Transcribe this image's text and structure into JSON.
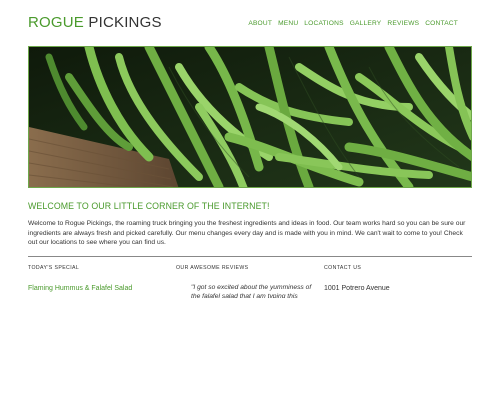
{
  "site": {
    "logo_part1": "ROGUE",
    "logo_part2": " PICKINGS"
  },
  "nav": [
    {
      "label": "ABOUT"
    },
    {
      "label": "MENU"
    },
    {
      "label": "LOCATIONS"
    },
    {
      "label": "GALLERY"
    },
    {
      "label": "REVIEWS"
    },
    {
      "label": "CONTACT"
    }
  ],
  "colors": {
    "accent": "#4a9a2c",
    "text": "#333333",
    "hero_border": "#6ea84a"
  },
  "welcome": {
    "title": "WELCOME TO OUR LITTLE CORNER OF THE INTERNET!",
    "body": "Welcome to Rogue Pickings, the roaming truck bringing you the freshest ingredients and ideas in food. Our team works hard so you can be sure our ingredients are always fresh and picked carefully. Our menu changes every day and is made with you in mind. We can't wait to come to you! Check out our locations to see where you can find us."
  },
  "columns": {
    "special": {
      "heading": "TODAY'S SPECIAL",
      "item": "Flaming Hummus & Falafel Salad"
    },
    "reviews": {
      "heading": "OUR AWESOME REVIEWS",
      "quote": "\"I got so excited about the yumminess of the falafel salad that I am typing this"
    },
    "contact": {
      "heading": "CONTACT US",
      "address": "1001 Potrero Avenue"
    }
  }
}
